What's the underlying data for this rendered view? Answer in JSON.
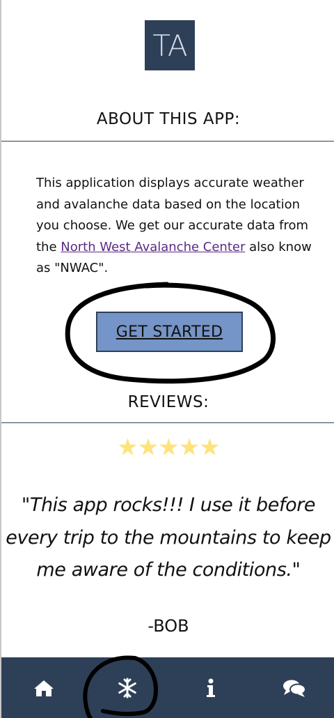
{
  "logo": {
    "text": "TA"
  },
  "about": {
    "heading": "ABOUT THIS APP:",
    "text_before_link": "This application displays accurate weather and avalanche data based on the location you choose. We get our accurate data from the ",
    "link_text": "North West Avalanche Center",
    "text_after_link": " also know as \"NWAC\"."
  },
  "cta": {
    "label": "GET STARTED"
  },
  "reviews": {
    "heading": "REVIEWS:",
    "rating": 5,
    "stars": "★★★★★",
    "quote": "\"This app rocks!!! I use it before every trip to the mountains to keep me aware of the conditions.\"",
    "author": "-BOB"
  },
  "nav": {
    "items": [
      {
        "icon": "home-icon"
      },
      {
        "icon": "snowflake-icon"
      },
      {
        "icon": "info-icon"
      },
      {
        "icon": "chat-icon"
      }
    ]
  },
  "colors": {
    "brand_navy": "#2e4057",
    "button_blue": "#7594c7",
    "star_yellow": "#fde37a",
    "link_purple": "#5b2a86"
  }
}
